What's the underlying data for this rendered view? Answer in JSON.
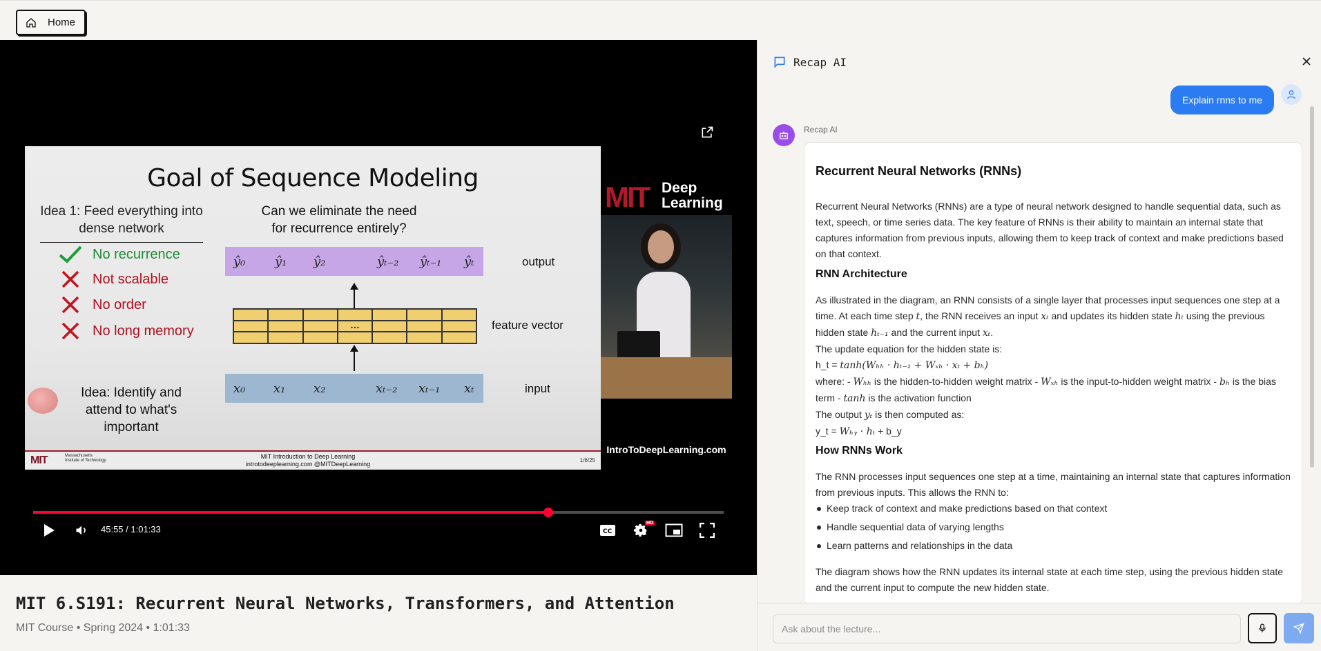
{
  "topbar": {
    "home_label": "Home"
  },
  "slide": {
    "title": "Goal of Sequence Modeling",
    "idea1": "Idea 1: Feed everything into dense network",
    "checks": [
      {
        "label": "No recurrence",
        "ok": true
      },
      {
        "label": "Not scalable",
        "ok": false
      },
      {
        "label": "No order",
        "ok": false
      },
      {
        "label": "No long memory",
        "ok": false
      }
    ],
    "question": "Can we eliminate the need for recurrence entirely?",
    "output_tokens": [
      "ŷ₀",
      "ŷ₁",
      "ŷ₂",
      "ŷₜ₋₂",
      "ŷₜ₋₁",
      "ŷₜ"
    ],
    "input_tokens": [
      "x₀",
      "x₁",
      "x₂",
      "xₜ₋₂",
      "xₜ₋₁",
      "xₜ"
    ],
    "feature_dots": "…",
    "label_output": "output",
    "label_feature": "feature vector",
    "label_input": "input",
    "idea2": "Idea: Identify and attend to what's important",
    "footer_logo": "MIT",
    "footer_institute": "Massachusetts Institute of Technology",
    "footer_course": "MIT Introduction to Deep Learning",
    "footer_links": "introtodeeplearning.com   @MITDeepLearning",
    "footer_page": "1/6/25"
  },
  "stream_overlay": {
    "logo": "MIT",
    "brand": "Deep Learning",
    "site": "IntroToDeepLearning.com"
  },
  "player": {
    "time": "45:55 / 1:01:33",
    "progress": 0.7458,
    "hd_badge": "HD",
    "progress_color": "#ff0033"
  },
  "video": {
    "title": "MIT 6.S191: Recurrent Neural Networks, Transformers, and Attention",
    "meta": "MIT Course • Spring 2024 • 1:01:33"
  },
  "chat": {
    "title": "Recap AI",
    "user_message": "Explain rnns to me",
    "bot_name": "Recap AI",
    "answer": {
      "heading": "Recurrent Neural Networks (RNNs)",
      "intro": "Recurrent Neural Networks (RNNs) are a type of neural network designed to handle sequential data, such as text, speech, or time series data. The key feature of RNNs is their ability to maintain an internal state that captures information from previous inputs, allowing them to keep track of context and make predictions based on that context.",
      "arch_heading": "RNN Architecture",
      "arch_p1_a": "As illustrated in the diagram, an RNN consists of a single layer that processes input sequences one step at a time. At each time step ",
      "arch_p1_t": "t",
      "arch_p1_b": ", the RNN receives an input ",
      "arch_p1_xt": "xₜ",
      "arch_p1_c": " and updates its hidden state ",
      "arch_p1_ht": "hₜ",
      "arch_p1_d": " using the previous hidden state ",
      "arch_p1_htm1": "hₜ₋₁",
      "arch_p1_e": " and the current input ",
      "arch_p1_xt2": "xₜ",
      "arch_p1_f": ".",
      "update_line": "The update equation for the hidden state is:",
      "eq_lhs": "h_t = ",
      "eq_rhs": "tanh(Wₕₕ · hₜ₋₁ + Wₓₕ · xₜ + bₕ)",
      "where_a": "where: - ",
      "where_whh": "Wₕₕ",
      "where_b": " is the hidden-to-hidden weight matrix - ",
      "where_wxh": "Wₓₕ",
      "where_c": " is the input-to-hidden weight matrix - ",
      "where_bh": "bₕ",
      "where_d": " is the bias term - ",
      "where_tanh": "tanh",
      "where_e": " is the activation function",
      "output_a": "The output ",
      "output_yt": "yₜ",
      "output_b": " is then computed as:",
      "out_eq_lhs": "y_t = ",
      "out_eq_mid": "Wₕᵧ · hₜ",
      "out_eq_rhs": " + b_y",
      "how_heading": "How RNNs Work",
      "how_p": "The RNN processes input sequences one step at a time, maintaining an internal state that captures information from previous inputs. This allows the RNN to:",
      "bullets": [
        "Keep track of context and make predictions based on that context",
        "Handle sequential data of varying lengths",
        "Learn patterns and relationships in the data"
      ],
      "closing": "The diagram shows how the RNN updates its internal state at each time step, using the previous hidden state and the current input to compute the new hidden state."
    },
    "input_placeholder": "Ask about the lecture...",
    "send_color": "#7eaaf0",
    "user_bubble_color": "#2b7bf2"
  }
}
